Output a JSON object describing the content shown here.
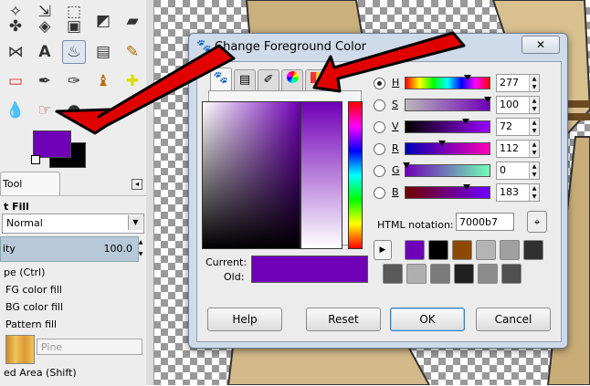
{
  "toolbox": {
    "tab_label": "Tool Options",
    "fill_label": "t Fill",
    "mode_value": "Normal",
    "opacity_label": "ity",
    "opacity_value": "100.0",
    "fill_type_label": "pe  (Ctrl)",
    "fill_options": [
      "FG color fill",
      "BG color fill",
      "Pattern fill"
    ],
    "pattern_name": "Pine",
    "affected_area": "ed Area  (Shift)",
    "fg_color": "#7000b7",
    "bg_color": "#000000"
  },
  "dialog": {
    "title": "Change Foreground Color",
    "close_glyph": "✕",
    "channels": [
      {
        "letter": "H",
        "value": "277",
        "selected": true
      },
      {
        "letter": "S",
        "value": "100",
        "selected": false
      },
      {
        "letter": "V",
        "value": "72",
        "selected": false
      },
      {
        "letter": "R",
        "value": "112",
        "selected": false
      },
      {
        "letter": "G",
        "value": "0",
        "selected": false
      },
      {
        "letter": "B",
        "value": "183",
        "selected": false
      }
    ],
    "html_notation_label": "HTML notation:",
    "html_notation_value": "7000b7",
    "current_label": "Current:",
    "old_label": "Old:",
    "current_color": "#7000b7",
    "history_colors": [
      "#7000b7",
      "#000000",
      "#8b4a00",
      "#b4b4b4",
      "#a0a0a0",
      "#303030",
      "#5a5a5a",
      "#b0b0b0",
      "#7a7a7a",
      "#202020",
      "#8c8c8c",
      "#505050"
    ],
    "buttons": {
      "help": "Help",
      "reset": "Reset",
      "ok": "OK",
      "cancel": "Cancel"
    }
  }
}
